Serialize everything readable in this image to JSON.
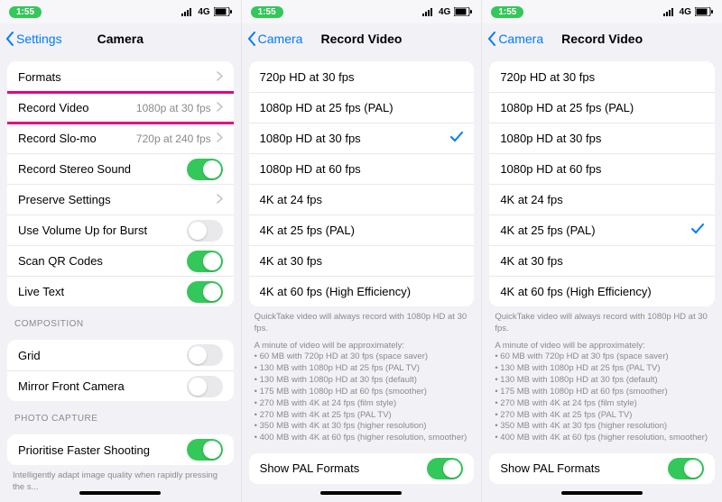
{
  "status": {
    "time": "1:55",
    "net": "4G"
  },
  "p1": {
    "back": "Settings",
    "title": "Camera",
    "rows": {
      "formats": "Formats",
      "record_video": "Record Video",
      "record_video_val": "1080p at 30 fps",
      "record_slomo": "Record Slo-mo",
      "record_slomo_val": "720p at 240 fps",
      "stereo": "Record Stereo Sound",
      "stereo_on": true,
      "preserve": "Preserve Settings",
      "vol_burst": "Use Volume Up for Burst",
      "vol_burst_on": false,
      "qr": "Scan QR Codes",
      "qr_on": true,
      "live": "Live Text",
      "live_on": true
    },
    "section_composition": "COMPOSITION",
    "comp": {
      "grid": "Grid",
      "grid_on": false,
      "mirror": "Mirror Front Camera",
      "mirror_on": false
    },
    "section_capture": "PHOTO CAPTURE",
    "capture": {
      "prioritise": "Prioritise Faster Shooting",
      "prioritise_on": true
    },
    "footer": "Intelligently adapt image quality when rapidly pressing the s..."
  },
  "p2": {
    "back": "Camera",
    "title": "Record Video",
    "options": [
      {
        "label": "720p HD at 30 fps"
      },
      {
        "label": "1080p HD at 25 fps (PAL)"
      },
      {
        "label": "1080p HD at 30 fps",
        "checked": true
      },
      {
        "label": "1080p HD at 60 fps"
      },
      {
        "label": "4K at 24 fps"
      },
      {
        "label": "4K at 25 fps (PAL)"
      },
      {
        "label": "4K at 30 fps"
      },
      {
        "label": "4K at 60 fps (High Efficiency)"
      }
    ],
    "hint": "QuickTake video will always record with 1080p HD at 30 fps.",
    "approx_intro": "A minute of video will be approximately:",
    "approx": [
      "60 MB with 720p HD at 30 fps (space saver)",
      "130 MB with 1080p HD at 25 fps (PAL TV)",
      "130 MB with 1080p HD at 30 fps (default)",
      "175 MB with 1080p HD at 60 fps (smoother)",
      "270 MB with 4K at 24 fps (film style)",
      "270 MB with 4K at 25 fps (PAL TV)",
      "350 MB with 4K at 30 fps (higher resolution)",
      "400 MB with 4K at 60 fps (higher resolution, smoother)"
    ],
    "pal": "Show PAL Formats",
    "pal_on": true
  },
  "p3": {
    "back": "Camera",
    "title": "Record Video",
    "options": [
      {
        "label": "720p HD at 30 fps"
      },
      {
        "label": "1080p HD at 25 fps (PAL)"
      },
      {
        "label": "1080p HD at 30 fps"
      },
      {
        "label": "1080p HD at 60 fps"
      },
      {
        "label": "4K at 24 fps"
      },
      {
        "label": "4K at 25 fps (PAL)",
        "checked": true
      },
      {
        "label": "4K at 30 fps"
      },
      {
        "label": "4K at 60 fps (High Efficiency)"
      }
    ],
    "hint": "QuickTake video will always record with 1080p HD at 30 fps.",
    "approx_intro": "A minute of video will be approximately:",
    "approx": [
      "60 MB with 720p HD at 30 fps (space saver)",
      "130 MB with 1080p HD at 25 fps (PAL TV)",
      "130 MB with 1080p HD at 30 fps (default)",
      "175 MB with 1080p HD at 60 fps (smoother)",
      "270 MB with 4K at 24 fps (film style)",
      "270 MB with 4K at 25 fps (PAL TV)",
      "350 MB with 4K at 30 fps (higher resolution)",
      "400 MB with 4K at 60 fps (higher resolution, smoother)"
    ],
    "pal": "Show PAL Formats",
    "pal_on": true
  }
}
